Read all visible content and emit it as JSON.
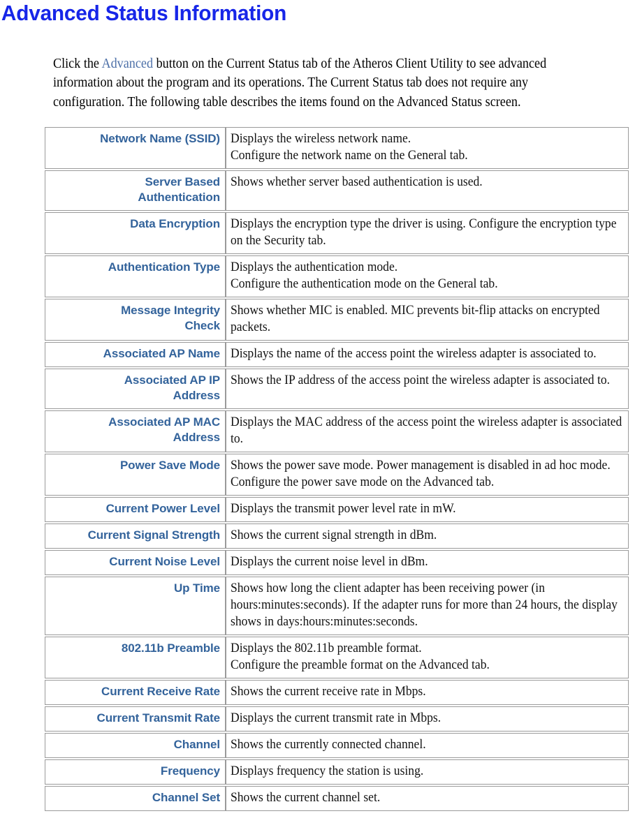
{
  "colors": {
    "title_blue": "#1726e8",
    "label_blue": "#33639b",
    "link_blue": "#4d70a8",
    "border_gray": "#9a9a9a",
    "body_text": "#121212"
  },
  "page": {
    "title": "Advanced Status Information",
    "intro": {
      "before_link": "Click the ",
      "link_text": "Advanced",
      "after_link": " button on the Current Status tab of the Atheros Client Utility to see advanced information about the program and its operations. The Current Status tab does not require any configuration.  The following table describes the items found on the Advanced Status screen."
    }
  },
  "table": {
    "rows": [
      {
        "label": "Network Name (SSID)",
        "description": "Displays the wireless network name.\nConfigure the network name on the General tab."
      },
      {
        "label": "Server Based\nAuthentication",
        "description": "Shows whether server based authentication is used."
      },
      {
        "label": "Data Encryption",
        "description": "Displays the encryption type the driver is using.   Configure the encryption type on the Security tab."
      },
      {
        "label": "Authentication Type",
        "description": "Displays the authentication mode.\nConfigure the authentication mode on the General tab."
      },
      {
        "label": "Message Integrity\nCheck",
        "description": "Shows whether MIC is enabled. MIC prevents bit-flip attacks on encrypted packets."
      },
      {
        "label": "Associated AP Name",
        "description": "Displays the name of the access point the wireless adapter is associated to."
      },
      {
        "label": "Associated AP IP\nAddress",
        "description": "Shows the IP address of the access point the wireless adapter is associated to."
      },
      {
        "label": "Associated AP MAC\nAddress",
        "description": "Displays the MAC address of the access point the wireless adapter is associated to."
      },
      {
        "label": "Power Save Mode",
        "description": "Shows the power save mode. Power management is disabled in ad hoc mode.\nConfigure the power save mode on the Advanced tab."
      },
      {
        "label": "Current Power Level",
        "description": "Displays the transmit power level rate in mW."
      },
      {
        "label": "Current Signal Strength",
        "description": "Shows the current signal strength in dBm."
      },
      {
        "label": "Current Noise Level",
        "description": "Displays the current noise level in dBm."
      },
      {
        "label": "Up Time",
        "description": "Shows how long the client adapter has been receiving power (in hours:minutes:seconds). If the adapter runs for more than 24 hours, the display shows in days:hours:minutes:seconds."
      },
      {
        "label": "802.11b Preamble",
        "description": "Displays the 802.11b preamble format.\nConfigure the preamble format on the Advanced tab."
      },
      {
        "label": "Current Receive Rate",
        "description": "Shows the current receive rate in Mbps."
      },
      {
        "label": "Current Transmit Rate",
        "description": "Displays the current transmit rate in Mbps."
      },
      {
        "label": "Channel",
        "description": "Shows the currently connected channel."
      },
      {
        "label": "Frequency",
        "description": "Displays frequency the station is using."
      },
      {
        "label": "Channel Set",
        "description": "Shows the current channel set."
      }
    ]
  }
}
